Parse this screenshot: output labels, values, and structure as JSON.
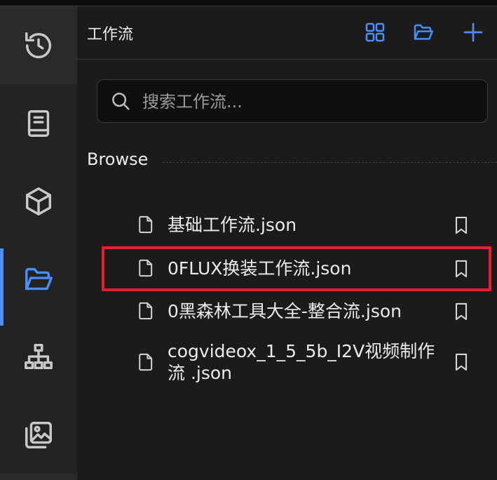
{
  "panel": {
    "title": "工作流"
  },
  "search": {
    "placeholder": "搜索工作流..."
  },
  "browse": {
    "label": "Browse"
  },
  "files": [
    {
      "name": "基础工作流.json"
    },
    {
      "name": "0FLUX换装工作流.json"
    },
    {
      "name": "0黑森林工具大全-整合流.json"
    },
    {
      "name": "cogvideox_1_5_5b_I2V视频制作流 .json"
    }
  ],
  "icons": {
    "rail": [
      "history-icon",
      "book-icon",
      "cube-icon",
      "folder-open-icon",
      "sitemap-icon",
      "images-icon"
    ],
    "header": [
      "grid-icon",
      "folder-open-icon",
      "plus-icon"
    ]
  },
  "colors": {
    "accent": "#4d8df6",
    "highlight": "#e2232e"
  }
}
